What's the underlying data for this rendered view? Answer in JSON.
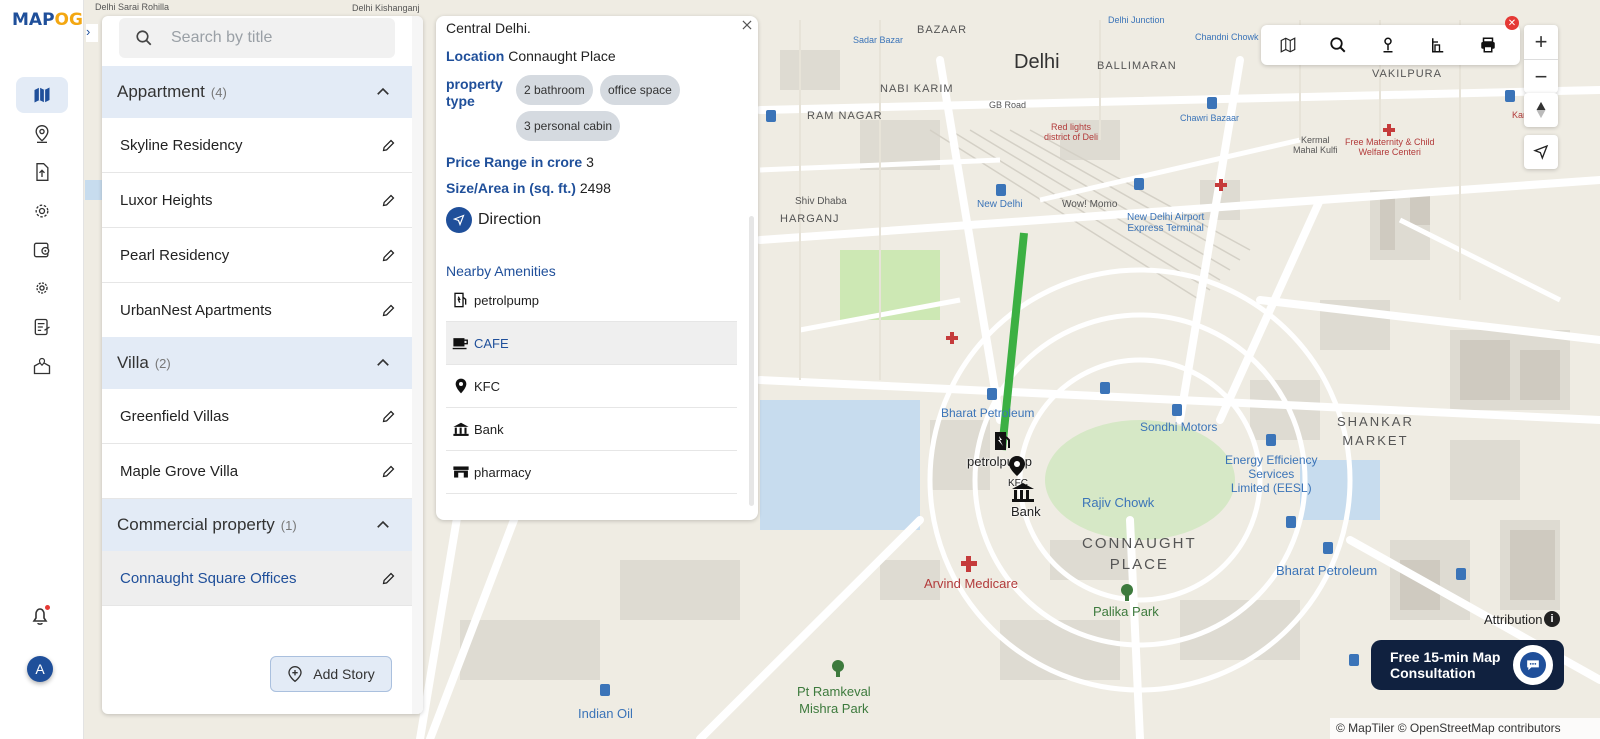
{
  "app": {
    "logo_text": "MAP",
    "logo_accent": "OG",
    "brand_color": "#1f4f9a",
    "accent_color": "#f3a712"
  },
  "rail": {
    "icons": [
      "map-icon",
      "location-pin-icon",
      "upload-icon",
      "settings-cog-icon",
      "map-pin-board-icon",
      "gear-icon",
      "report-icon",
      "map-location-icon"
    ],
    "notification_icon": "bell-icon",
    "avatar_letter": "A"
  },
  "panel": {
    "search": {
      "placeholder": "Search by title",
      "value": ""
    },
    "groups": [
      {
        "title": "Appartment",
        "count": "(4)",
        "items": [
          "Skyline Residency",
          "Luxor Heights",
          "Pearl Residency",
          "UrbanNest Apartments"
        ]
      },
      {
        "title": "Villa",
        "count": "(2)",
        "items": [
          "Greenfield Villas",
          "Maple Grove Villa"
        ]
      },
      {
        "title": "Commercial property",
        "count": "(1)",
        "items": [
          "Connaught Square Offices"
        ]
      }
    ],
    "add_story_label": "Add Story"
  },
  "popup": {
    "description_tail": "Central Delhi.",
    "location_label": "Location",
    "location_value": "Connaught Place",
    "property_type_label": "property type",
    "property_types": [
      "2 bathroom",
      "office space",
      "3 personal cabin"
    ],
    "price_label": "Price Range in crore",
    "price_value": "3",
    "size_label": "Size/Area in (sq. ft.)",
    "size_value": "2498",
    "direction_label": "Direction",
    "amenities_title": "Nearby Amenities",
    "amenities": [
      {
        "label": "petrolpump",
        "icon": "fuel-station-icon"
      },
      {
        "label": "CAFE",
        "icon": "coffee-cup-icon"
      },
      {
        "label": "KFC",
        "icon": "map-pin-icon"
      },
      {
        "label": "Bank",
        "icon": "bank-icon"
      },
      {
        "label": "pharmacy",
        "icon": "store-icon"
      }
    ]
  },
  "map": {
    "labels": {
      "delhi": "Delhi",
      "ballimaran": "BALLIMARAN",
      "bazaar": "BAZAAR",
      "vakilpura": "VAKILPURA",
      "nabi_karim": "NABI KARIM",
      "ram_nagar": "RAM NAGAR",
      "gb_road": "GB Road",
      "red_lights": "Red lights\ndistrict of Deli",
      "chawri_bazaar": "Chawri Bazaar",
      "kermal": "Kermal\nMahal Kulfi",
      "free_maternity": "Free Maternity & Child\nWelfare Centeri",
      "karims": "Karim's",
      "new_delhi": "New Delhi",
      "wow_momo": "Wow! Momo",
      "nd_airport": "New Delhi Airport\nExpress Terminal",
      "shiv_dhaba": "Shiv Dhaba",
      "harganj": "HARGANJ",
      "bharat_petroleum_1": "Bharat Petroleum",
      "sondhi_motors": "Sondhi Motors",
      "shankar_market": "SHANKAR\nMARKET",
      "eesl": "Energy Efficiency\nServices\nLimited (EESL)",
      "rajiv_chowk": "Rajiv Chowk",
      "connaught_place": "CONNAUGHT\nPLACE",
      "arvind_medicare": "Arvind Medicare",
      "palika_park": "Palika Park",
      "bharat_petroleum_2": "Bharat Petroleum",
      "pt_ramkeval": "Pt Ramkeval\nMishra Park",
      "indian_oil": "Indian Oil",
      "delhi_sarai_rohilla": "Delhi Sarai Rohilla",
      "delhi_kishanganj": "Delhi Kishanganj",
      "sadar_bazar": "Sadar Bazar",
      "delhi_junction": "Delhi Junction",
      "chandni_chowk": "Chandni Chowk",
      "marker_petrolpump": "petrolpump",
      "marker_bank": "Bank",
      "marker_kfc": "KFC"
    },
    "route_color": "#3cb043"
  },
  "toolbar": {
    "icons": [
      "map-layers-icon",
      "search-icon",
      "pin-icon",
      "building-icon",
      "print-icon"
    ]
  },
  "zoom": {
    "in": "+",
    "out": "−"
  },
  "attribution": {
    "label": "Attribution",
    "info": "i",
    "copyright": "© MapTiler © OpenStreetMap contributors"
  },
  "consult": {
    "line1": "Free 15-min Map",
    "line2": "Consultation"
  }
}
